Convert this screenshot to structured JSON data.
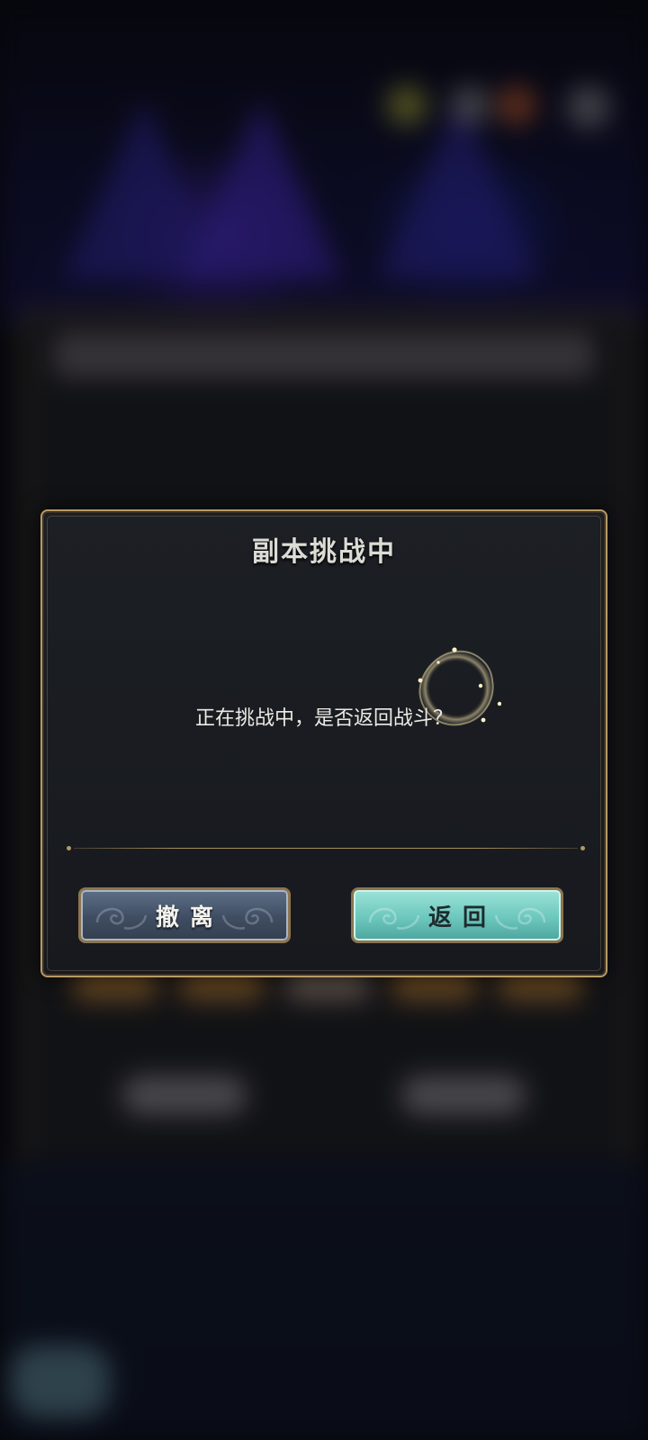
{
  "dialog": {
    "title": "副本挑战中",
    "message": "正在挑战中，是否返回战斗？"
  },
  "buttons": {
    "leave_label": "撤离",
    "return_label": "返回"
  },
  "colors": {
    "frame_gold": "#b89a63",
    "dialog_bg": "#1c1f24",
    "leave_button": "#4b5b70",
    "return_button": "#6cc7bd"
  },
  "icons": {
    "decoration": "sparkle-ring-icon"
  }
}
